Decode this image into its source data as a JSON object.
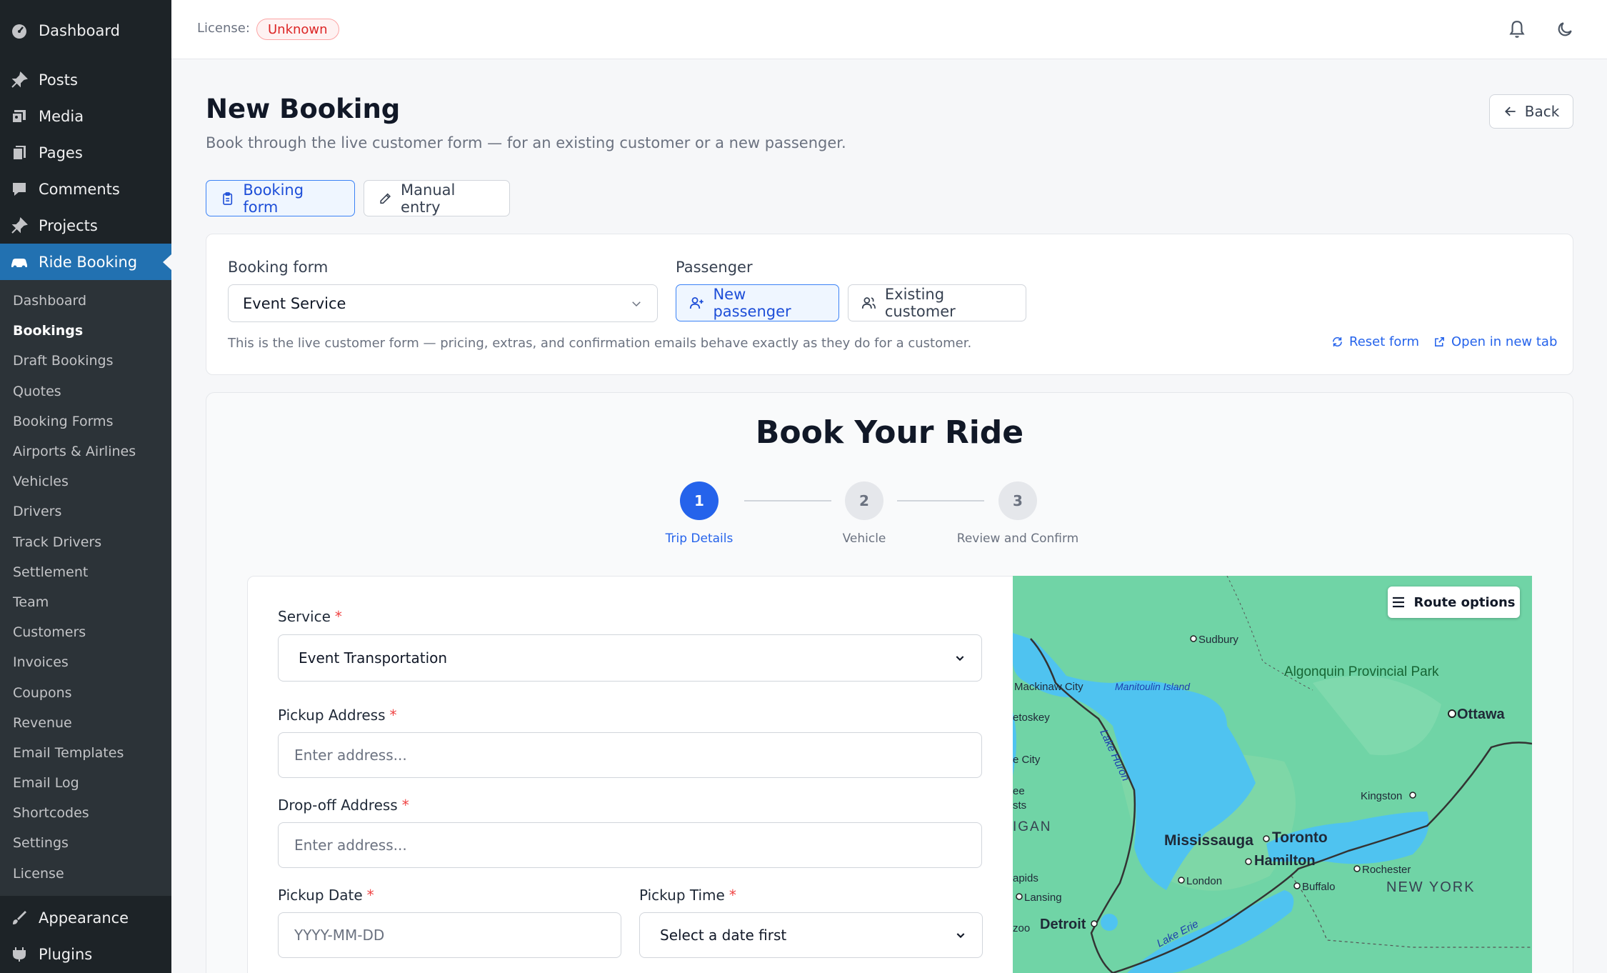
{
  "sidebar": {
    "top_items": [
      {
        "label": "Dashboard",
        "icon": "dashboard-icon"
      },
      {
        "label": "Posts",
        "icon": "pin-icon"
      },
      {
        "label": "Media",
        "icon": "media-icon"
      },
      {
        "label": "Pages",
        "icon": "pages-icon"
      },
      {
        "label": "Comments",
        "icon": "comment-icon"
      },
      {
        "label": "Projects",
        "icon": "pin-icon"
      },
      {
        "label": "Ride Booking",
        "icon": "car-icon"
      }
    ],
    "sub_items": [
      "Dashboard",
      "Bookings",
      "Draft Bookings",
      "Quotes",
      "Booking Forms",
      "Airports & Airlines",
      "Vehicles",
      "Drivers",
      "Track Drivers",
      "Settlement",
      "Team",
      "Customers",
      "Invoices",
      "Coupons",
      "Revenue",
      "Email Templates",
      "Email Log",
      "Shortcodes",
      "Settings",
      "License"
    ],
    "bottom_items": [
      {
        "label": "Appearance",
        "icon": "brush-icon"
      },
      {
        "label": "Plugins",
        "icon": "plugin-icon"
      }
    ]
  },
  "topbar": {
    "license_label": "License:",
    "license_status": "Unknown"
  },
  "header": {
    "title": "New Booking",
    "subtitle": "Book through the live customer form — for an existing customer or a new passenger.",
    "back_label": "Back"
  },
  "tabs": {
    "booking_form": "Booking form",
    "manual_entry": "Manual entry"
  },
  "config": {
    "form_label": "Booking form",
    "form_value": "Event Service",
    "passenger_label": "Passenger",
    "new_passenger": "New passenger",
    "existing_customer": "Existing customer",
    "note": "This is the live customer form — pricing, extras, and confirmation emails behave exactly as they do for a customer.",
    "reset_form": "Reset form",
    "open_new_tab": "Open in new tab"
  },
  "booking": {
    "title": "Book Your Ride",
    "steps": [
      {
        "number": "1",
        "label": "Trip Details"
      },
      {
        "number": "2",
        "label": "Vehicle"
      },
      {
        "number": "3",
        "label": "Review and Confirm"
      }
    ],
    "service_label": "Service",
    "service_value": "Event Transportation",
    "pickup_label": "Pickup Address",
    "pickup_placeholder": "Enter address...",
    "dropoff_label": "Drop-off Address",
    "dropoff_placeholder": "Enter address...",
    "date_label": "Pickup Date",
    "date_placeholder": "YYYY-MM-DD",
    "time_label": "Pickup Time",
    "time_value": "Select a date first",
    "required_mark": "*"
  },
  "map": {
    "route_options": "Route options",
    "labels": [
      "Sudbury",
      "Mackinaw City",
      "Manitoulin Island",
      "Algonquin Provincial Park",
      "Ottawa",
      "etoskey",
      "Lake Huron",
      "e City",
      "ee",
      "sts",
      "IGAN",
      "Kingston",
      "Mississauga",
      "Toronto",
      "Hamilton",
      "Rochester",
      "London",
      "apids",
      "Lansing",
      "Buffalo",
      "NEW YORK",
      "zoo",
      "Detroit",
      "Lake Erie"
    ]
  }
}
